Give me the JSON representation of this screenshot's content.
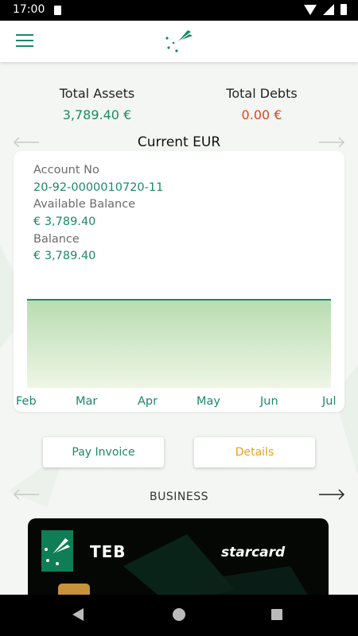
{
  "status_bar": {
    "time": "17:00"
  },
  "totals": {
    "assets_label": "Total Assets",
    "assets_value": "3,789.40 €",
    "debts_label": "Total Debts",
    "debts_value": "0.00 €"
  },
  "account": {
    "title": "Current EUR",
    "account_no_label": "Account No",
    "account_no": "20-92-0000010720-11",
    "available_label": "Available Balance",
    "available_value": "€ 3,789.40",
    "balance_label": "Balance",
    "balance_value": "€ 3,789.40"
  },
  "chart_data": {
    "type": "area",
    "categories": [
      "Feb",
      "Mar",
      "Apr",
      "May",
      "Jun",
      "Jul"
    ],
    "series": [
      {
        "values": [
          3789.4,
          3789.4,
          3789.4,
          3789.4,
          3789.4,
          3789.4
        ]
      }
    ]
  },
  "buttons": {
    "pay_invoice": "Pay Invoice",
    "details": "Details"
  },
  "business_section": {
    "label": "BUSINESS"
  },
  "card": {
    "brand": "TEB",
    "product": "starcard"
  },
  "colors": {
    "green": "#1a8a66",
    "orange": "#e6a21e",
    "red": "#e0441c"
  }
}
